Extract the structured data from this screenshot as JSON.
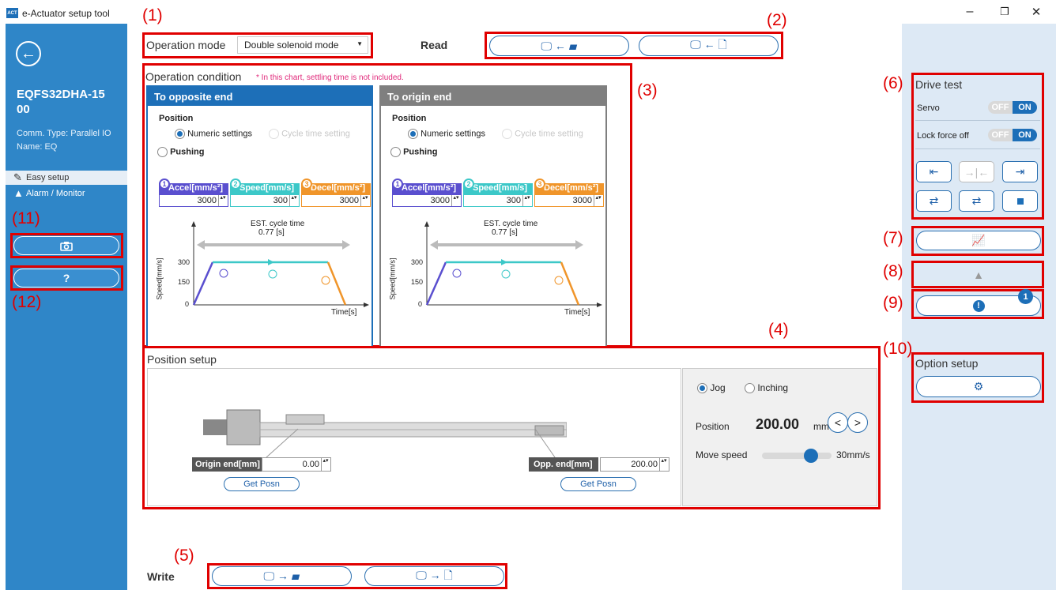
{
  "window": {
    "title": "e-Actuator setup tool",
    "logo_text": "ACT",
    "controls": {
      "minimize": "–",
      "restore": "❐",
      "close": "✕"
    }
  },
  "sidebar": {
    "model": "EQFS32DHA-1500",
    "model_line1": "EQFS32DHA-15",
    "model_line2": "00",
    "comm": "Comm. Type: Parallel IO",
    "name": "Name: EQ",
    "nav": [
      {
        "label": "Easy setup",
        "icon": "pencil-icon"
      },
      {
        "label": "Alarm / Monitor",
        "icon": "warning-icon"
      }
    ],
    "help_label": "?"
  },
  "callouts": [
    "(1)",
    "(2)",
    "(3)",
    "(4)",
    "(5)",
    "(6)",
    "(7)",
    "(8)",
    "(9)",
    "(10)",
    "(11)",
    "(12)"
  ],
  "operation_mode": {
    "label": "Operation mode",
    "value": "Double solenoid mode"
  },
  "read": {
    "label": "Read"
  },
  "write": {
    "label": "Write"
  },
  "condition": {
    "title": "Operation condition",
    "note": "* In this chart, settling time is not included.",
    "panels": [
      {
        "title": "To opposite end",
        "header_color": "#1d6fb8",
        "position_label": "Position",
        "numeric": "Numeric settings",
        "cycle": "Cycle time setting",
        "pushing": "Pushing",
        "params": [
          {
            "num": "1",
            "label": "Accel[mm/s²]",
            "value": "3000",
            "color": "#5a4fcf"
          },
          {
            "num": "2",
            "label": "Speed[mm/s]",
            "value": "300",
            "color": "#3cc8c8"
          },
          {
            "num": "3",
            "label": "Decel[mm/s²]",
            "value": "3000",
            "color": "#f0952a"
          }
        ],
        "est_label": "EST. cycle time",
        "est_value": "0.77 [s]",
        "ylabel": "Speed[mm/s]",
        "xlabel": "Time[s]",
        "yticks": [
          "300",
          "150",
          "0"
        ]
      },
      {
        "title": "To origin end",
        "header_color": "#7f7f7f",
        "position_label": "Position",
        "numeric": "Numeric settings",
        "cycle": "Cycle time setting",
        "pushing": "Pushing",
        "params": [
          {
            "num": "1",
            "label": "Accel[mm/s²]",
            "value": "3000",
            "color": "#5a4fcf"
          },
          {
            "num": "2",
            "label": "Speed[mm/s]",
            "value": "300",
            "color": "#3cc8c8"
          },
          {
            "num": "3",
            "label": "Decel[mm/s²]",
            "value": "3000",
            "color": "#f0952a"
          }
        ],
        "est_label": "EST. cycle time",
        "est_value": "0.77 [s]",
        "ylabel": "Speed[mm/s]",
        "xlabel": "Time[s]",
        "yticks": [
          "300",
          "150",
          "0"
        ]
      }
    ]
  },
  "position_setup": {
    "title": "Position setup",
    "origin_label": "Origin end[mm]",
    "origin_value": "0.00",
    "opp_label": "Opp. end[mm]",
    "opp_value": "200.00",
    "get_posn": "Get Posn",
    "jog": "Jog",
    "inching": "Inching",
    "position_label": "Position",
    "position_value": "200.00",
    "position_unit": "mm",
    "move_speed_label": "Move speed",
    "move_speed_value": "30mm/s",
    "move_speed_level": 0.75
  },
  "drive_test": {
    "title": "Drive test",
    "servo": "Servo",
    "lock_force_off": "Lock force off",
    "off": "OFF",
    "on": "ON"
  },
  "alarm_badge": "1",
  "option_setup": {
    "title": "Option setup"
  },
  "colors": {
    "sidebar": "#2f86c8",
    "accent": "#1d6fb8",
    "right_panel": "#dde9f5",
    "callout": "#e00000"
  }
}
